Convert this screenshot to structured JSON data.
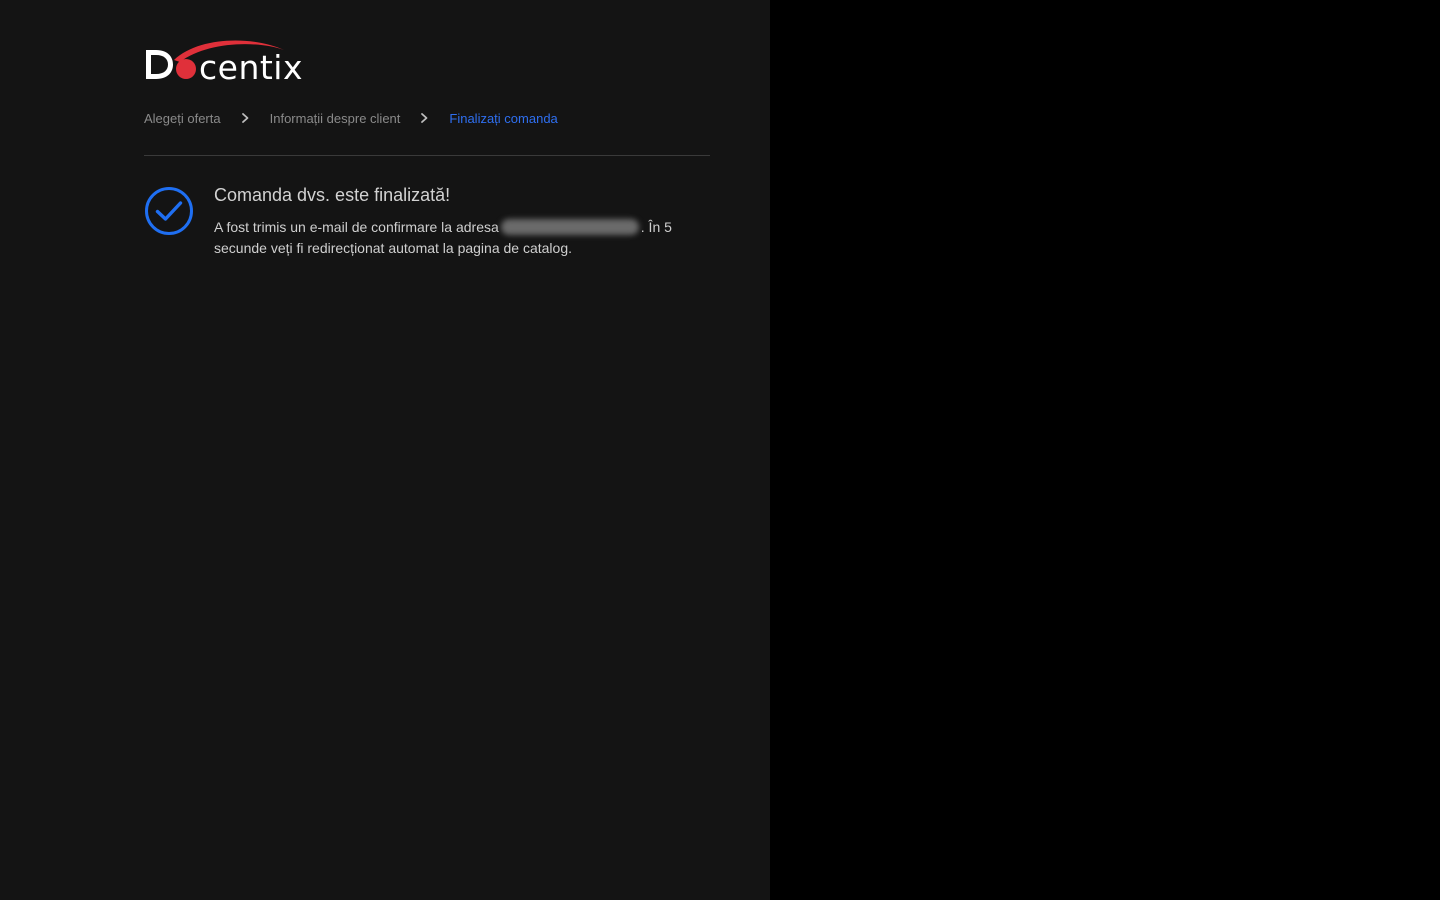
{
  "brand": {
    "logo_text": "Docentix",
    "accent_color": "#e0303a",
    "logo_icon": "docentix-logo"
  },
  "breadcrumb": {
    "steps": [
      {
        "label": "Alegeți oferta",
        "state": "done"
      },
      {
        "label": "Informații despre client",
        "state": "done"
      },
      {
        "label": "Finalizați comanda",
        "state": "active"
      }
    ],
    "separator_icon": "chevron-right-icon",
    "active_color": "#2f6ff0"
  },
  "confirmation": {
    "icon": "check-circle-icon",
    "icon_color": "#1f6ff2",
    "title": "Comanda dvs. este finalizată!",
    "text_before_email": "A fost trimis un e-mail de confirmare la adresa",
    "text_after_email": ". În 5 secunde veți fi redirecționat automat la pagina de catalog."
  }
}
